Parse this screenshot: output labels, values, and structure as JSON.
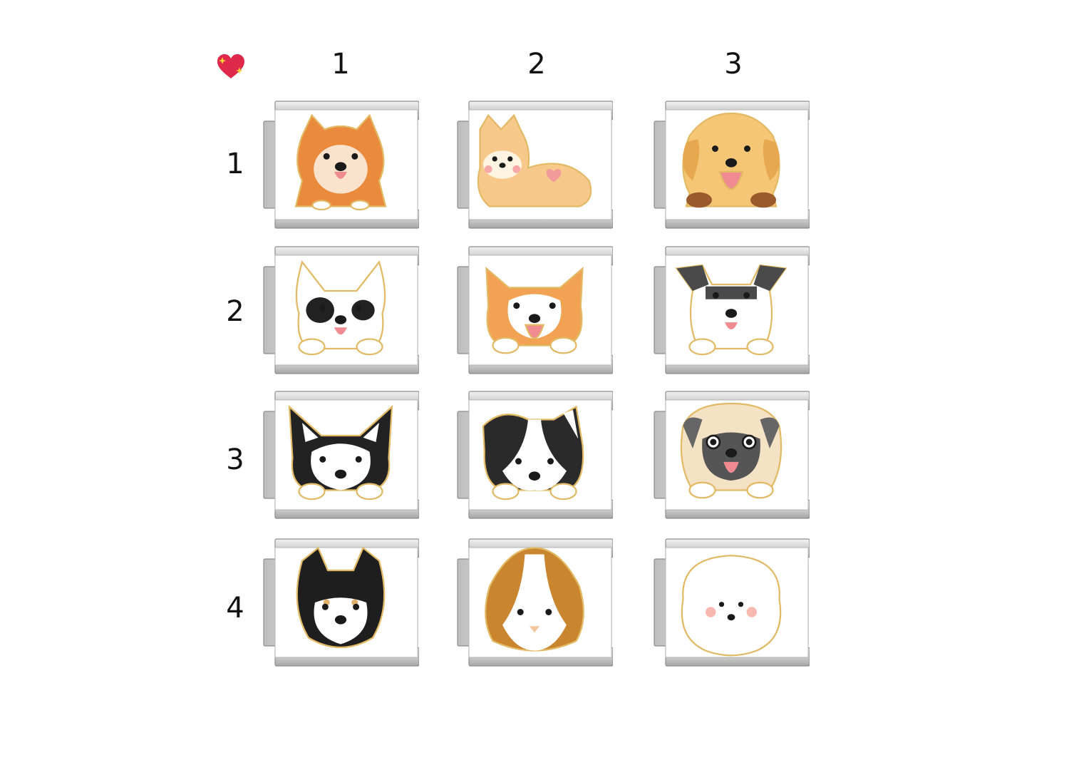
{
  "corner_icon": "sparkling-heart-icon",
  "columns": [
    {
      "label": "1"
    },
    {
      "label": "2"
    },
    {
      "label": "3"
    }
  ],
  "rows": [
    {
      "label": "1"
    },
    {
      "label": "2"
    },
    {
      "label": "3"
    },
    {
      "label": "4"
    }
  ],
  "charms": [
    {
      "row": 1,
      "col": 1,
      "breed": "pomeranian",
      "fur": "#e98a3c",
      "face": "#fbe2cc"
    },
    {
      "row": 1,
      "col": 2,
      "breed": "corgi-lying",
      "fur": "#f6c98b",
      "face": "#fff4e2"
    },
    {
      "row": 1,
      "col": 3,
      "breed": "golden-retriever",
      "fur": "#f5c676",
      "face": "#fbe0aa"
    },
    {
      "row": 2,
      "col": 1,
      "breed": "french-bulldog",
      "fur": "#222222",
      "face": "#ffffff"
    },
    {
      "row": 2,
      "col": 2,
      "breed": "shiba-peeking",
      "fur": "#f2a253",
      "face": "#ffffff"
    },
    {
      "row": 2,
      "col": 3,
      "breed": "schnauzer",
      "fur": "#4a4a4a",
      "face": "#ffffff"
    },
    {
      "row": 3,
      "col": 1,
      "breed": "husky",
      "fur": "#222222",
      "face": "#ffffff"
    },
    {
      "row": 3,
      "col": 2,
      "breed": "border-collie",
      "fur": "#2a2a2a",
      "face": "#ffffff"
    },
    {
      "row": 3,
      "col": 3,
      "breed": "pug",
      "fur": "#f4e2c4",
      "face": "#555555"
    },
    {
      "row": 4,
      "col": 1,
      "breed": "black-shiba",
      "fur": "#1e1e1e",
      "face": "#ffffff"
    },
    {
      "row": 4,
      "col": 2,
      "breed": "beagle",
      "fur": "#c9862f",
      "face": "#ffffff"
    },
    {
      "row": 4,
      "col": 3,
      "breed": "bichon",
      "fur": "#ffffff",
      "face": "#ffffff"
    }
  ],
  "colors": {
    "gold_outline": "#e2b964",
    "steel": "#d4d4d4",
    "steel_dark": "#9a9a9a",
    "nose": "#1a1a1a",
    "tongue": "#f08b92"
  }
}
